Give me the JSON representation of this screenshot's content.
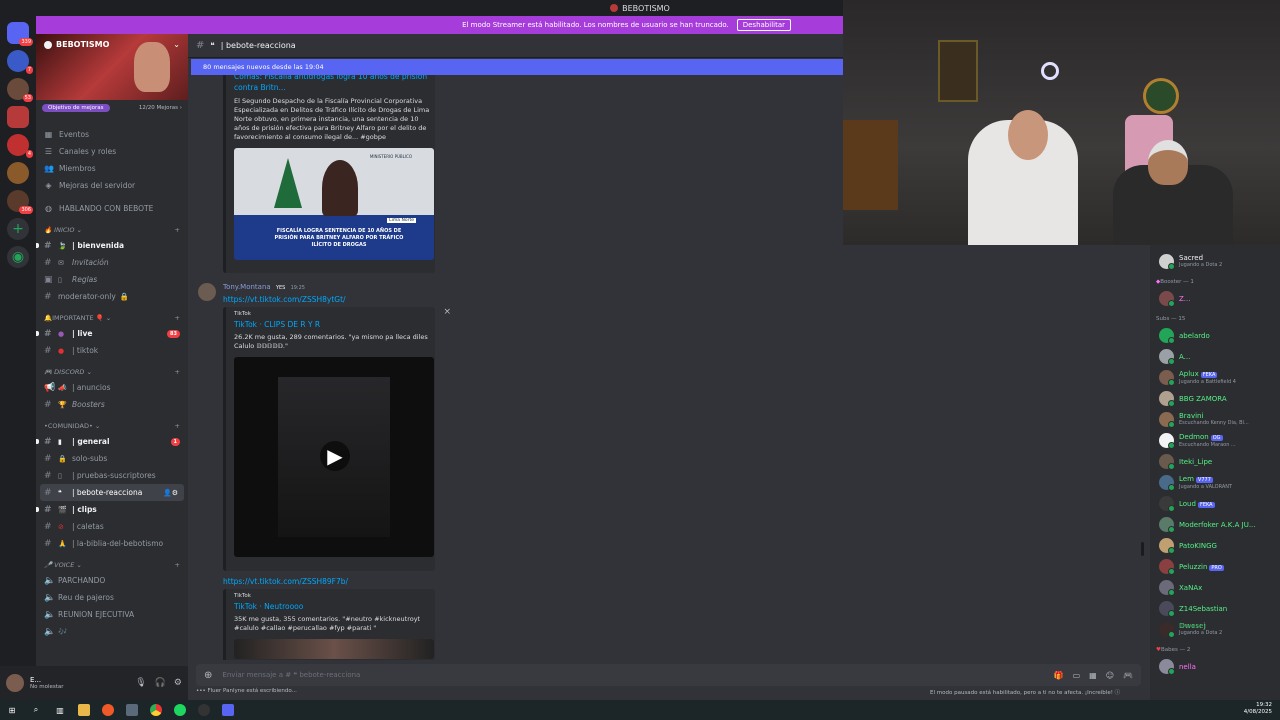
{
  "window": {
    "title": "BEBOTISMO"
  },
  "streamer_bar": {
    "text": "El modo Streamer está habilitado. Los nombres de usuario se han truncado.",
    "button": "Deshabilitar"
  },
  "guild_badges": [
    "339",
    "7",
    "53",
    "4",
    "306"
  ],
  "server": {
    "name": "BEBOTISMO",
    "boost_goal": "Objetivo de mejoras",
    "boost_progress": "12/20 Mejoras",
    "boost_arrow": "›"
  },
  "menu": [
    {
      "label": "Eventos",
      "icon": "▦"
    },
    {
      "label": "Canales y roles",
      "icon": "☰"
    },
    {
      "label": "Miembros",
      "icon": "👥"
    },
    {
      "label": "Mejoras del servidor",
      "icon": "◈"
    }
  ],
  "hablando": "HABLANDO CON BEBOTE",
  "categories": {
    "inicio": "INICIO",
    "importante": "IMPORTANTE",
    "discord": "DISCORD",
    "comunidad": "•COMUNIDAD•",
    "voice": "VOICE"
  },
  "channels": {
    "bienvenida": "| bienvenida",
    "invitacion": "Invitación",
    "reglas": "Reglas",
    "moderator": "moderator-only",
    "live": "| live",
    "live_badge": "83",
    "tiktok": "| tiktok",
    "anuncios": "| anuncios",
    "boosters": "Boosters",
    "general": "| general",
    "general_badge": "1",
    "solosubs": "solo-subs",
    "pruebas": "| pruebas-suscriptores",
    "bebote": "| bebote-reacciona",
    "clips": "| clips",
    "caletas": "| caletas",
    "biblia": "| la-biblia-del-bebotismo",
    "parchando": "PARCHANDO",
    "reu": "Reu de pajeros",
    "reunion": "REUNION EJECUTIVA"
  },
  "user": {
    "name": "E...",
    "status": "No molestar"
  },
  "channel_header": {
    "name": "| bebote-reacciona"
  },
  "new_messages": "80 mensajes nuevos desde las 19:04",
  "embed1": {
    "title": "Comas: Fiscalía antidrogas logra 10 años de prisión contra Britn...",
    "desc": "El Segundo Despacho de la Fiscalía Provincial Corporativa Especializada en Delitos de Tráfico Ilícito de Drogas de Lima Norte obtuvo, en primera instancia, una sentencia de 10 años de prisión efectiva para Britney Alfaro por el delito de favorecimiento al consumo ilegal de... #gobpe",
    "img_caption": "FISCALÍA LOGRA SENTENCIA DE 10 AÑOS DE PRISIÓN PARA BRITNEY ALFARO POR TRÁFICO ILÍCITO DE DROGAS",
    "img_header": "MINISTERIO PÚBLICO",
    "img_tag": "Lima Norte"
  },
  "msg": {
    "author": "Tony.Montana",
    "tag": "YES",
    "time": "19:25",
    "link1": "https://vt.tiktok.com/ZSSH8ytGt/",
    "embed2": {
      "provider": "TikTok",
      "title": "TikTok · CLIPS DE R Y R",
      "desc": "26.2K me gusta, 289 comentarios. \"ya mismo pa lleca diles Calulo 𝔻𝔻𝔻𝔻𝔻.\""
    },
    "link2": "https://vt.tiktok.com/ZSSH89F7b/",
    "embed3": {
      "provider": "TikTok",
      "title": "TikTok · Neutroooo",
      "desc": "35K me gusta, 355 comentarios. \"#neutro #kickneutroyt #calulo #callao #perucallao #fyp #parati \""
    }
  },
  "composer": {
    "placeholder": "Enviar mensaje a #",
    "channel": "bebote-reacciona"
  },
  "typing": "Fluer Panlyne está escribiendo...",
  "slowmode": "El modo pausado está habilitado, pero a ti no te afecta. ¡Increíble!",
  "members": {
    "top": {
      "name": "Sacred",
      "activity": "Jugando a Dota 2",
      "color": "#f2f3f5"
    },
    "booster_header": "Booster — 1",
    "booster": {
      "name": "Z...",
      "color": "#ff73fa"
    },
    "subs_header": "Subs — 15",
    "subs": [
      {
        "name": "abelardo",
        "activity": "",
        "tag": "",
        "av": "#23a559"
      },
      {
        "name": "A...",
        "activity": "",
        "tag": "",
        "av": "#9aa0a6"
      },
      {
        "name": "Aplux",
        "activity": "Jugando a Battlefield 4",
        "tag": "FEKA",
        "av": "#7a5d4e"
      },
      {
        "name": "BBG ZAMORA",
        "activity": "",
        "tag": "",
        "av": "#b0a090"
      },
      {
        "name": "Bravini",
        "activity": "Escuchando Kenny Dia, Bl...",
        "tag": "",
        "av": "#8a6a50"
      },
      {
        "name": "Dedmon",
        "activity": "Escuchando Maraon ...",
        "tag": "OG",
        "av": "#f2f3f5"
      },
      {
        "name": "Iteki_Lipe",
        "activity": "",
        "tag": "",
        "av": "#6a5a4e"
      },
      {
        "name": "Lem",
        "activity": "Jugando a VALORANT",
        "tag": "V777",
        "av": "#4a6a8a"
      },
      {
        "name": "Loud",
        "activity": "",
        "tag": "FEKA",
        "av": "#3a3a3a"
      },
      {
        "name": "Moderfoker A.K.A JU...",
        "activity": "",
        "tag": "",
        "av": "#5a7a6a"
      },
      {
        "name": "PatoKINGG",
        "activity": "",
        "tag": "",
        "av": "#c0a070"
      },
      {
        "name": "Peluzzin",
        "activity": "",
        "tag": "PRO",
        "av": "#8a4040"
      },
      {
        "name": "XaNAx",
        "activity": "",
        "tag": "",
        "av": "#6a6a7a"
      },
      {
        "name": "Z14Sebastian",
        "activity": "",
        "tag": "",
        "av": "#4a4a5a"
      },
      {
        "name": "𝔻𝕨𝕠𝕤𝕖𝕛",
        "activity": "Jugando a Dota 2",
        "tag": "",
        "av": "#3a2a2a"
      }
    ],
    "babes_header": "Babes — 2",
    "babe": {
      "name": "nella",
      "color": "#ff73fa"
    }
  },
  "clock": {
    "time": "19:32",
    "date": "4/08/2025"
  }
}
